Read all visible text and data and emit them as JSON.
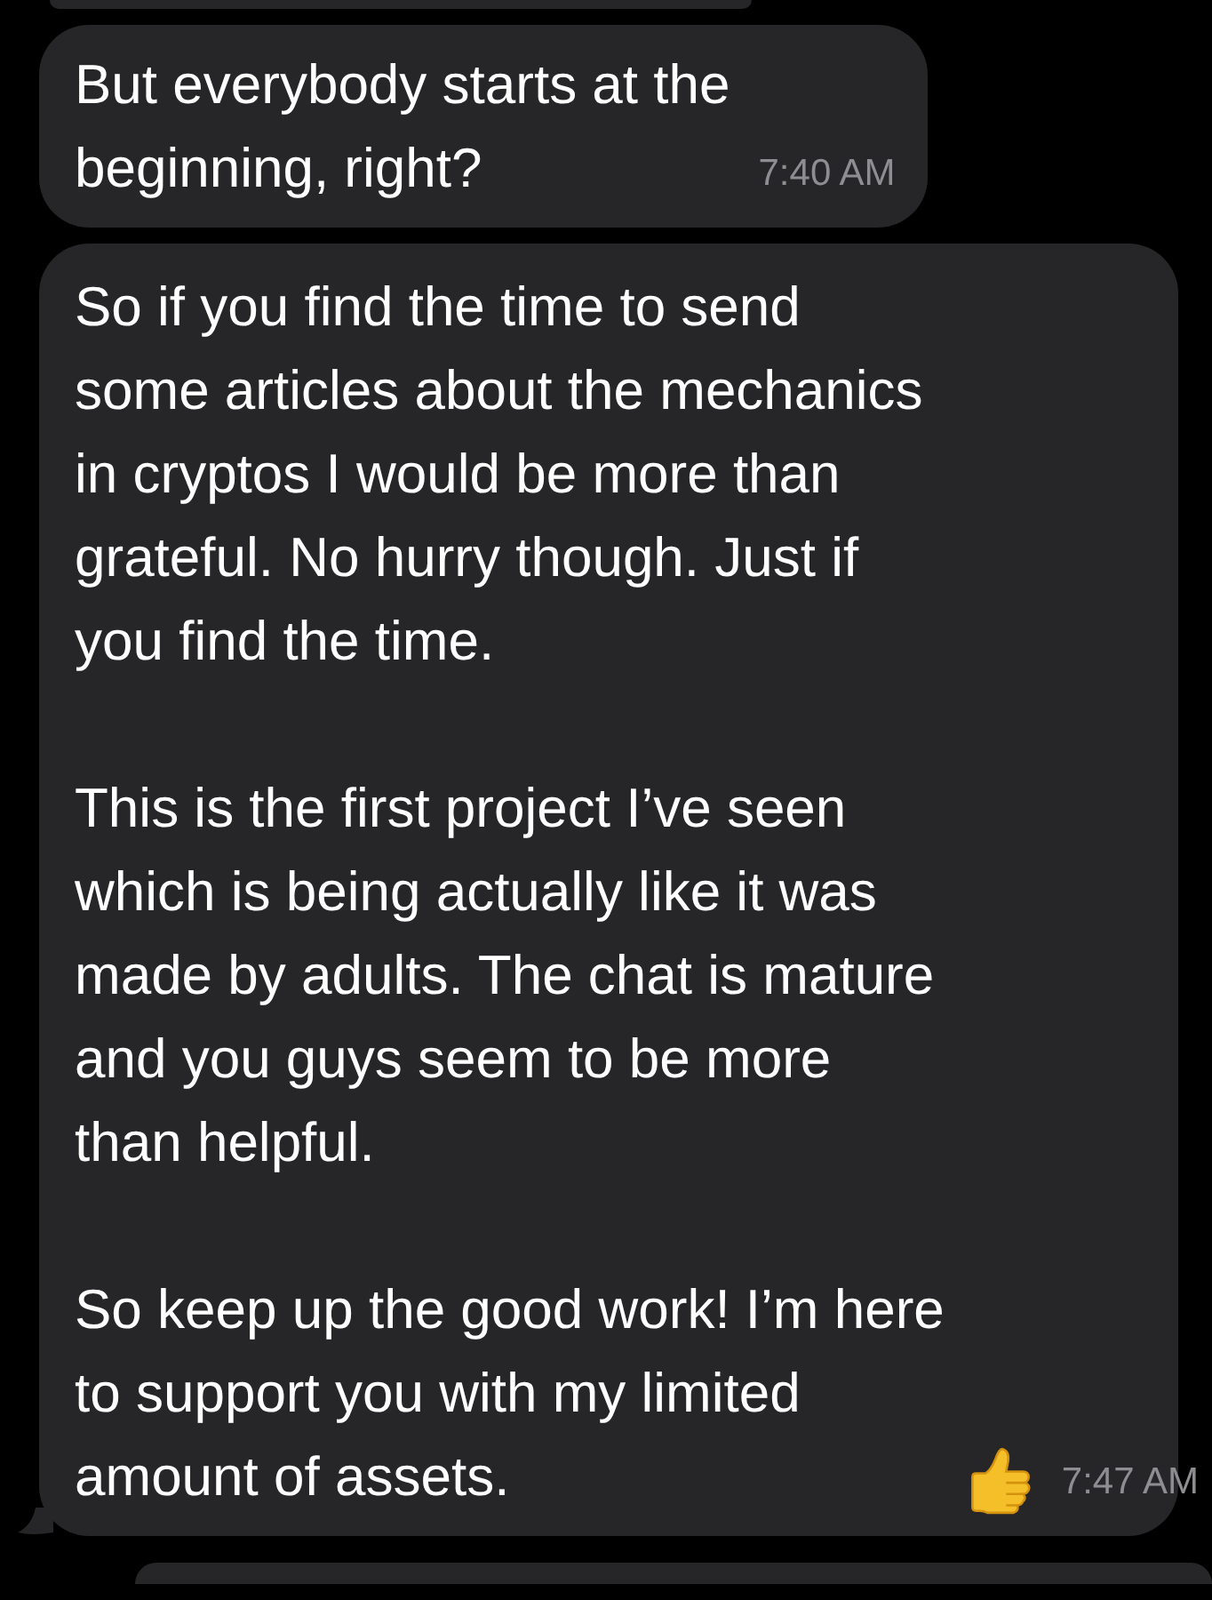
{
  "messages": [
    {
      "paragraphs": [
        "But everybody starts at the\nbeginning, right?"
      ],
      "time": "7:40 AM",
      "trailing_icon": false,
      "tail": false
    },
    {
      "paragraphs": [
        "So if you find the time to send\nsome articles about the mechanics\nin cryptos I would be more than\ngrateful. No hurry though. Just if\nyou find the time.",
        "This is the first project I’ve seen\nwhich is being actually like it was\nmade by adults. The chat is mature\nand you guys seem to be more\nthan helpful.",
        "So keep up the good work! I’m here\nto support you with my limited\namount of assets."
      ],
      "time": "7:47 AM",
      "trailing_icon": true,
      "tail": true
    }
  ]
}
